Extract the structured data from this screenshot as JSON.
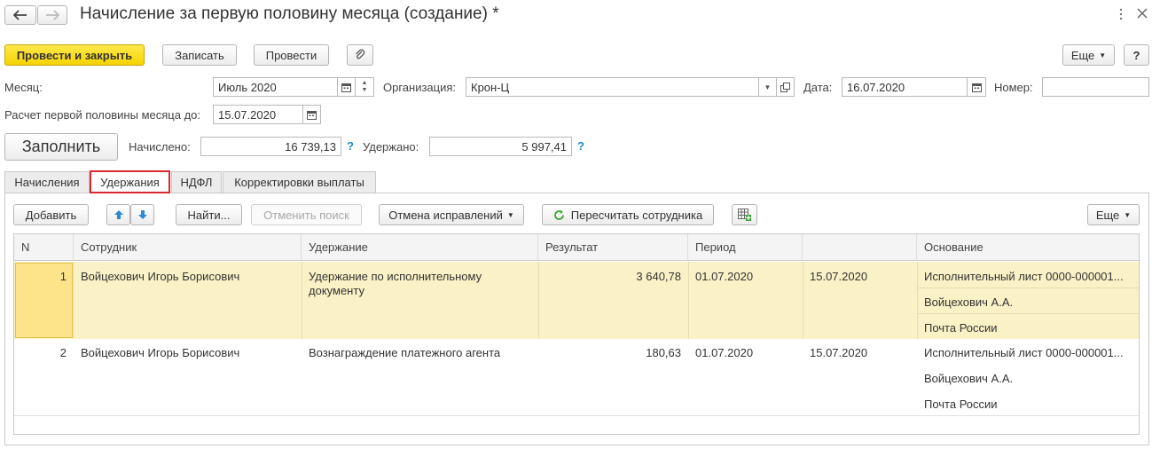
{
  "window": {
    "title": "Начисление за первую половину месяца (создание) *"
  },
  "toolbar": {
    "post_close": "Провести и закрыть",
    "save": "Записать",
    "post": "Провести",
    "more": "Еще",
    "help": "?"
  },
  "header": {
    "month_label": "Месяц:",
    "month_value": "Июль 2020",
    "org_label": "Организация:",
    "org_value": "Крон-Ц",
    "date_label": "Дата:",
    "date_value": "16.07.2020",
    "number_label": "Номер:",
    "number_value": "",
    "calc_label": "Расчет первой половины месяца до:",
    "calc_value": "15.07.2020",
    "fill_button": "Заполнить",
    "accrued_label": "Начислено:",
    "accrued_value": "16 739,13",
    "withheld_label": "Удержано:",
    "withheld_value": "5 997,41",
    "q": "?"
  },
  "tabs": [
    {
      "label": "Начисления"
    },
    {
      "label": "Удержания"
    },
    {
      "label": "НДФЛ"
    },
    {
      "label": "Корректировки выплаты"
    }
  ],
  "table_toolbar": {
    "add": "Добавить",
    "find": "Найти...",
    "cancel_search": "Отменить поиск",
    "cancel_fixes": "Отмена исправлений",
    "recalc": "Пересчитать сотрудника",
    "more": "Еще"
  },
  "table": {
    "columns": [
      "N",
      "Сотрудник",
      "Удержание",
      "Результат",
      "Период",
      "",
      "Основание"
    ],
    "rows": [
      {
        "n": "1",
        "employee": "Войцехович Игорь Борисович",
        "deduction": "Удержание по исполнительному документу",
        "result": "3 640,78",
        "period_start": "01.07.2020",
        "period_end": "15.07.2020",
        "basis": [
          "Исполнительный лист 0000-000001...",
          "Войцехович А.А.",
          "Почта России"
        ]
      },
      {
        "n": "2",
        "employee": "Войцехович Игорь Борисович",
        "deduction": "Вознаграждение платежного агента",
        "result": "180,63",
        "period_start": "01.07.2020",
        "period_end": "15.07.2020",
        "basis": [
          "Исполнительный лист 0000-000001...",
          "Войцехович А.А.",
          "Почта России"
        ]
      }
    ]
  }
}
